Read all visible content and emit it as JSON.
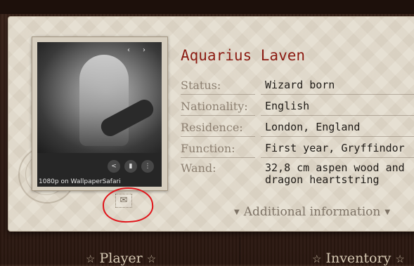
{
  "profile": {
    "name": "Aquarius Laven",
    "fields": [
      {
        "label": "Status:",
        "value": "Wizard born"
      },
      {
        "label": "Nationality:",
        "value": "English"
      },
      {
        "label": "Residence:",
        "value": "London, England"
      },
      {
        "label": "Function:",
        "value": "First year, Gryffindor"
      },
      {
        "label": "Wand:",
        "value": "32,8 cm aspen wood and\ndragon heartstring"
      }
    ],
    "additional_info": "Additional information"
  },
  "photo": {
    "caption": "1080p on WallpaperSafari",
    "nav_prev": "‹",
    "nav_next": "›"
  },
  "bottom_tabs": [
    {
      "label": "Player"
    },
    {
      "label": "Inventory"
    }
  ],
  "icons": {
    "mail": "mail-icon",
    "share": "share-icon",
    "bookmark": "bookmark-icon",
    "more": "more-icon"
  },
  "colors": {
    "name": "#8b1b12",
    "highlight": "#e0141a"
  }
}
